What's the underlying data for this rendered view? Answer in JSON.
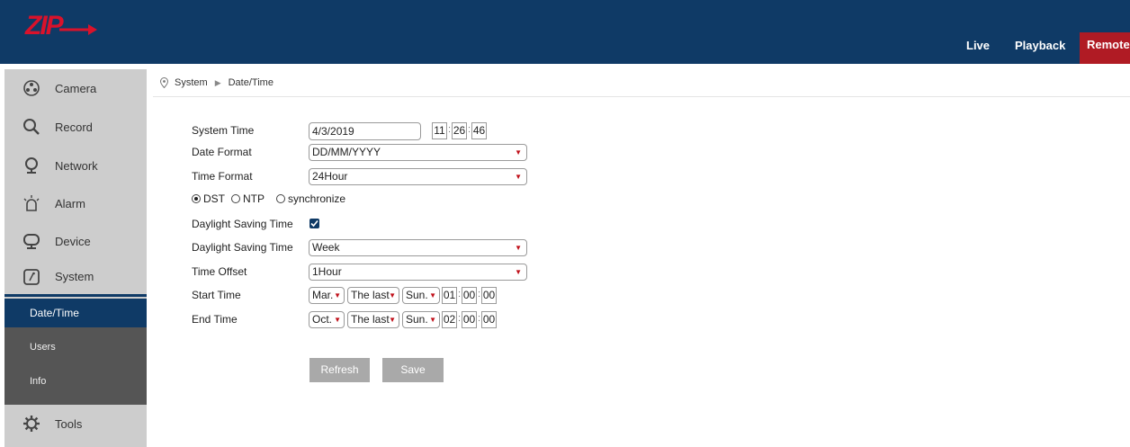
{
  "header": {
    "logo_text": "ZIP",
    "nav": {
      "live": "Live",
      "playback": "Playback",
      "remote": "Remote"
    }
  },
  "sidebar": {
    "items": [
      {
        "label": "Camera",
        "icon": "camera-icon"
      },
      {
        "label": "Record",
        "icon": "search-icon"
      },
      {
        "label": "Network",
        "icon": "network-icon"
      },
      {
        "label": "Alarm",
        "icon": "alarm-icon"
      },
      {
        "label": "Device",
        "icon": "device-icon"
      },
      {
        "label": "System",
        "icon": "system-icon"
      },
      {
        "label": "Tools",
        "icon": "gear-icon"
      }
    ],
    "submenu": [
      "Date/Time",
      "Users",
      "Info"
    ]
  },
  "breadcrumb": {
    "root": "System",
    "current": "Date/Time"
  },
  "form": {
    "system_time": {
      "label": "System Time",
      "date": "4/3/2019",
      "hour": "11",
      "minute": "26",
      "second": "46"
    },
    "date_format": {
      "label": "Date Format",
      "value": "DD/MM/YYYY"
    },
    "time_format": {
      "label": "Time Format",
      "value": "24Hour"
    },
    "mode": {
      "options": [
        "DST",
        "NTP",
        "synchronize"
      ],
      "selected": "DST"
    },
    "dst_enable": {
      "label": "Daylight Saving Time",
      "checked": true
    },
    "dst_mode": {
      "label": "Daylight Saving Time",
      "value": "Week"
    },
    "time_offset": {
      "label": "Time Offset",
      "value": "1Hour"
    },
    "start_time": {
      "label": "Start Time",
      "month": "Mar.",
      "week": "The last",
      "day": "Sun.",
      "hour": "01",
      "minute": "00",
      "second": "00"
    },
    "end_time": {
      "label": "End Time",
      "month": "Oct.",
      "week": "The last",
      "day": "Sun.",
      "hour": "02",
      "minute": "00",
      "second": "00"
    }
  },
  "buttons": {
    "refresh": "Refresh",
    "save": "Save"
  },
  "colors": {
    "header_bg": "#0f3a66",
    "accent_red": "#b01b24",
    "sidebar_bg": "#cdcdcd",
    "submenu_bg": "#555555",
    "button_bg": "#a9a9a9"
  }
}
